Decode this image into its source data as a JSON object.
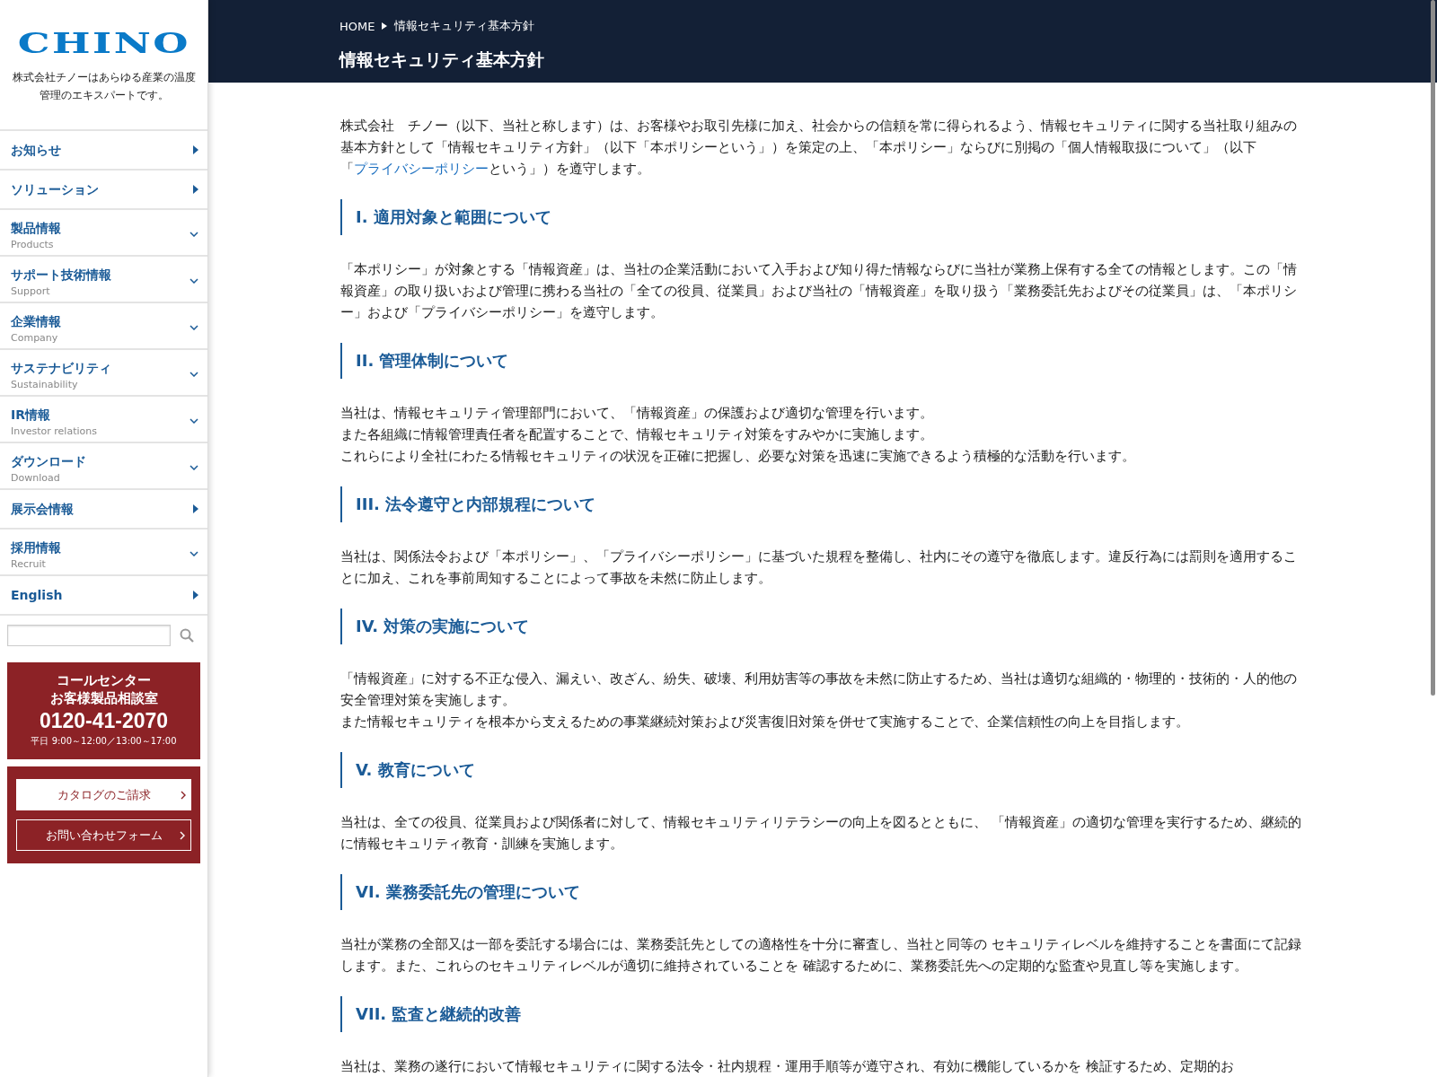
{
  "sidebar": {
    "logo": "CHINO",
    "tagline": "株式会社チノーはあらゆる産業の温度管理のエキスパートです。",
    "nav": [
      {
        "label": "お知らせ",
        "kind": "link"
      },
      {
        "label": "ソリューション",
        "kind": "link"
      },
      {
        "label": "製品情報",
        "sub": "Products",
        "kind": "dropdown"
      },
      {
        "label": "サポート技術情報",
        "sub": "Support",
        "kind": "dropdown"
      },
      {
        "label": "企業情報",
        "sub": "Company",
        "kind": "dropdown"
      },
      {
        "label": "サステナビリティ",
        "sub": "Sustainability",
        "kind": "dropdown"
      },
      {
        "label": "IR情報",
        "sub": "Investor relations",
        "kind": "dropdown"
      },
      {
        "label": "ダウンロード",
        "sub": "Download",
        "kind": "dropdown"
      },
      {
        "label": "展示会情報",
        "kind": "link"
      },
      {
        "label": "採用情報",
        "sub": "Recruit",
        "kind": "dropdown"
      },
      {
        "label": "English",
        "kind": "link"
      }
    ],
    "call_center": {
      "title": "コールセンター",
      "subtitle": "お客様製品相談室",
      "phone": "0120-41-2070",
      "hours": "平日 9:00～12:00／13:00～17:00"
    },
    "buttons": [
      {
        "label": "カタログのご請求",
        "kind": "solid"
      },
      {
        "label": "お問い合わせフォーム",
        "kind": "outline"
      }
    ]
  },
  "header": {
    "breadcrumb": [
      "HOME",
      "情報セキュリティ基本方針"
    ],
    "title": "情報セキュリティ基本方針"
  },
  "intro": {
    "before": "株式会社　チノー（以下、当社と称します）は、お客様やお取引先様に加え、社会からの信頼を常に得られるよう、情報セキュリティに関する当社取り組みの基本方針として「情報セキュリティ方針」（以下「本ポリシーという」）を策定の上、「本ポリシー」ならびに別掲の「個人情報取扱について」（以下「",
    "link": "プライバシーポリシー",
    "after": "という」）を遵守します。"
  },
  "sections": [
    {
      "heading": "I. 適用対象と範囲について",
      "lines": [
        "「本ポリシー」が対象とする「情報資産」は、当社の企業活動において入手および知り得た情報ならびに当社が業務上保有する全ての情報とします。この「情報資産」の取り扱いおよび管理に携わる当社の「全ての役員、従業員」および当社の「情報資産」を取り扱う「業務委託先およびその従業員」は、「本ポリシー」および「プライバシーポリシー」を遵守します。"
      ]
    },
    {
      "heading": "II. 管理体制について",
      "lines": [
        "当社は、情報セキュリティ管理部門において、「情報資産」の保護および適切な管理を行います。",
        "また各組織に情報管理責任者を配置することで、情報セキュリティ対策をすみやかに実施します。",
        "これらにより全社にわたる情報セキュリティの状況を正確に把握し、必要な対策を迅速に実施できるよう積極的な活動を行います。"
      ]
    },
    {
      "heading": "III. 法令遵守と内部規程について",
      "lines": [
        "当社は、関係法令および「本ポリシー」、「プライバシーポリシー」に基づいた規程を整備し、社内にその遵守を徹底します。違反行為には罰則を適用することに加え、これを事前周知することによって事故を未然に防止します。"
      ]
    },
    {
      "heading": "IV. 対策の実施について",
      "lines": [
        "「情報資産」に対する不正な侵入、漏えい、改ざん、紛失、破壊、利用妨害等の事故を未然に防止するため、当社は適切な組織的・物理的・技術的・人的他の安全管理対策を実施します。",
        "また情報セキュリティを根本から支えるための事業継続対策および災害復旧対策を併せて実施することで、企業信頼性の向上を目指します。"
      ]
    },
    {
      "heading": "V. 教育について",
      "lines": [
        "当社は、全ての役員、従業員および関係者に対して、情報セキュリティリテラシーの向上を図るとともに、 「情報資産」の適切な管理を実行するため、継続的に情報セキュリティ教育・訓練を実施します。"
      ]
    },
    {
      "heading": "VI. 業務委託先の管理について",
      "lines": [
        "当社が業務の全部又は一部を委託する場合には、業務委託先としての適格性を十分に審査し、当社と同等の セキュリティレベルを維持することを書面にて記録します。また、これらのセキュリティレベルが適切に維持されていることを 確認するために、業務委託先への定期的な監査や見直し等を実施します。"
      ]
    },
    {
      "heading": "VII. 監査と継続的改善",
      "lines": [
        "当社は、業務の遂行において情報セキュリティに関する法令・社内規程・運用手順等が遵守され、有効に機能しているかを 検証するため、定期的お"
      ]
    }
  ]
}
